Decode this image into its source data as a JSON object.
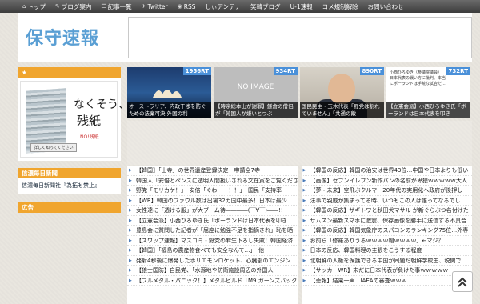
{
  "nav": [
    {
      "icon": "home-icon",
      "glyph": "⌂",
      "label": "トップ"
    },
    {
      "icon": "blog-icon",
      "glyph": "✎",
      "label": "ブログ案内"
    },
    {
      "icon": "list-icon",
      "glyph": "☰",
      "label": "記事一覧"
    },
    {
      "icon": "twitter-icon",
      "glyph": "✈",
      "label": "Twitter"
    },
    {
      "icon": "rss-icon",
      "glyph": "◉",
      "label": "RSS"
    },
    {
      "icon": "",
      "glyph": "",
      "label": "しぃアンテナ"
    },
    {
      "icon": "",
      "glyph": "",
      "label": "笑韓ブログ"
    },
    {
      "icon": "",
      "glyph": "",
      "label": "U-1速報"
    },
    {
      "icon": "",
      "glyph": "",
      "label": "コメ規制解除"
    },
    {
      "icon": "",
      "glyph": "",
      "label": "お問い合わせ"
    }
  ],
  "site": {
    "logo": "保守速報"
  },
  "sidebar": {
    "star_head": "★",
    "ad": {
      "line1": "なくそう、",
      "line2": "残紙",
      "line3": "NO!残紙",
      "button": "詳しく知ってください"
    },
    "news_head": "信濃毎日新聞",
    "news_link": "信濃毎日新聞社『為拓も禁止』",
    "ad_head": "広告"
  },
  "thumbs": [
    {
      "rt": "1956RT",
      "caption": "オーストラリア、内政干渉を防ぐための法案可決 外国の利"
    },
    {
      "rt": "934RT",
      "noimage": "NO IMAGE",
      "caption": "【時宗総本山が謝罪】鎌倉の僧侶が「韓国人が嫌いとつぶ"
    },
    {
      "rt": "890RT",
      "caption": "国民民主・玉木代表「野党は割れていません」「共通の敵"
    },
    {
      "rt": "732RT",
      "caption": "【立憲会派】小西ひろゆき氏「ボーランドは日本代表を叩き",
      "tweet": "小西ひろゆき（参議院議員） 日本代表の戦い方に批判、本当にポーランドは手荒な試合だ..."
    }
  ],
  "headlines": {
    "left": [
      "【韓国】「山寺」の世界遺産登録決定　申請全7寺",
      "韓国人「安倍とペンスに透明人間扱いされる文在寅をご覧くださ",
      "野党「モリカケ！」　安倍「ぐわーー！！」　国民「支持率",
      "【WR】韓国のファウル数は出場32カ国中最多！日本は最少",
      "女性達に「透ける服」が大ブーム待――――(￣∀￣)――!!",
      "【立憲会派】小西ひろゆき氏「ボーランドは日本代表を叩き",
      "豊島会に質問した記者が「屈座に勉強不足を指摘され」恥を晒",
      "【スワップ速報】マスコミ・野党の麻生下ろし失敗！韓国経済",
      "【韓国】「福島の農産物食べても安全なんて…」　他",
      "発射4秒後に爆発したホリエモンロケット、心臓部のエンジン",
      "【狼士国防】自民党、「水源地や防衛施設周辺の外国人",
      "【フルメタル・パニック！】メタルビルド「M9 ガーンズバック"
    ],
    "right": [
      "【韓国の反応】韓国の治安は世界43位…中国や日本よりも低い",
      "【画像】セブンイレブン新作パンの名前が卑猥ｗｗｗｗｗ大人",
      "【夢・未来】空飛ぶクルマ　20年代の実用化へ政府が後押し",
      "法事で親戚が集まってる時、いつもこの人は誰ってなるでし",
      "【韓国の反応】ザギトワと秋田犬マサル が新ぐらぶつ名付けた",
      "サムスン最新スマホに激震、保存画像を勝手に送信する不具合",
      "【韓国の反応】韓国気象庁のスパコンのランキング75位…外専",
      "お前ら「修羅ありうるｗｗｗｗ帽ｗｗｗｗ」←マジ？",
      "日本の反応、韓国料理の主張をこうする程度",
      "北朝鮮の人権を保護できる中国が同題だ朝鮮学校生、税関で",
      "【サッカーWR】末だに日本代表が負けた事ｗｗｗｗｗ ",
      "【悲報】結果一声　IAEAの審査ｗｗｗ"
    ]
  }
}
